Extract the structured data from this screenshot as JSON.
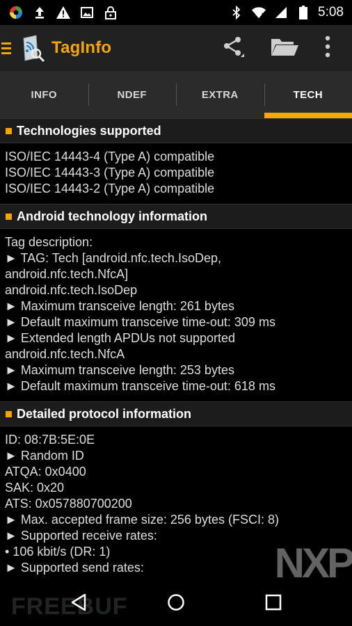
{
  "status_bar": {
    "time": "5:08",
    "left_icons": [
      "app-colorful-icon",
      "upload-icon",
      "warning-icon",
      "image-icon",
      "lock-icon"
    ],
    "right_icons": [
      "bluetooth-icon",
      "wifi-icon",
      "signal-icon",
      "battery-icon"
    ]
  },
  "app_bar": {
    "title": "TagInfo",
    "actions": [
      "share-icon",
      "folder-icon",
      "overflow-menu-icon"
    ]
  },
  "tabs": [
    {
      "label": "INFO",
      "active": false
    },
    {
      "label": "NDEF",
      "active": false
    },
    {
      "label": "EXTRA",
      "active": false
    },
    {
      "label": "TECH",
      "active": true
    }
  ],
  "sections": [
    {
      "title": "Technologies supported",
      "lines": [
        "ISO/IEC 14443-4 (Type A) compatible",
        "ISO/IEC 14443-3 (Type A) compatible",
        "ISO/IEC 14443-2 (Type A) compatible"
      ]
    },
    {
      "title": "Android technology information",
      "lines": [
        "Tag description:",
        "► TAG: Tech [android.nfc.tech.IsoDep,",
        "android.nfc.tech.NfcA]",
        "android.nfc.tech.IsoDep",
        "► Maximum transceive length: 261 bytes",
        "► Default maximum transceive time-out: 309 ms",
        "► Extended length APDUs not supported",
        "android.nfc.tech.NfcA",
        "► Maximum transceive length: 253 bytes",
        "► Default maximum transceive time-out: 618 ms"
      ]
    },
    {
      "title": "Detailed protocol information",
      "lines": [
        "ID: 08:7B:5E:0E",
        "► Random ID",
        "ATQA: 0x0400",
        "SAK: 0x20",
        "ATS: 0x057880700200",
        "► Max. accepted frame size: 256 bytes (FSCI: 8)",
        "► Supported receive rates:",
        " • 106 kbit/s (DR: 1)",
        "► Supported send rates:"
      ]
    }
  ],
  "watermarks": {
    "nxp": "NXP",
    "freebuf": "FREEBUF"
  },
  "colors": {
    "accent": "#f7a600",
    "app_bar": "#212121",
    "tab_bar": "#2b2b2b",
    "section_header": "#1c1c1c"
  }
}
